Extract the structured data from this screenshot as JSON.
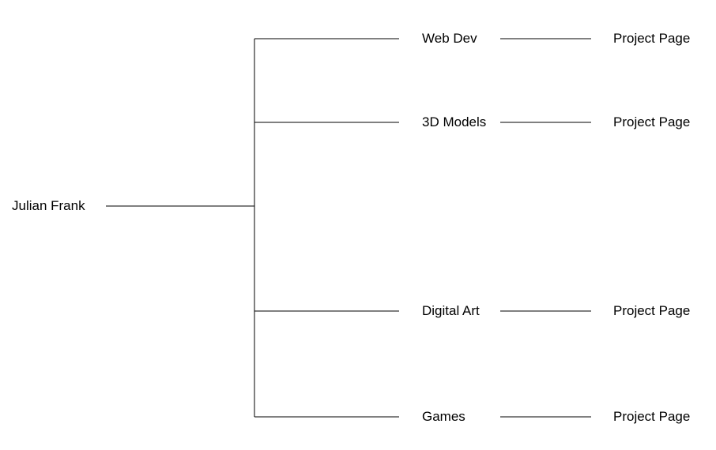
{
  "root": {
    "label": "Julian Frank"
  },
  "branches": [
    {
      "label": "Web Dev",
      "link_label": "Project Page"
    },
    {
      "label": "3D Models",
      "link_label": "Project Page"
    },
    {
      "label": "Digital Art",
      "link_label": "Project Page"
    },
    {
      "label": "Games",
      "link_label": "Project Page"
    }
  ],
  "colors": {
    "line": "#000000",
    "text": "#000000",
    "background": "#ffffff"
  }
}
